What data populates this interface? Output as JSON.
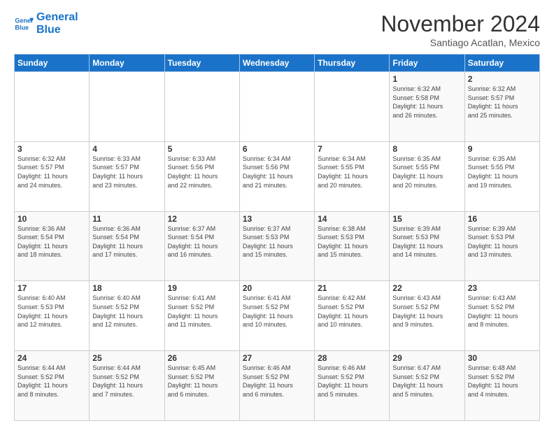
{
  "logo": {
    "line1": "General",
    "line2": "Blue"
  },
  "header": {
    "month": "November 2024",
    "location": "Santiago Acatlan, Mexico"
  },
  "weekdays": [
    "Sunday",
    "Monday",
    "Tuesday",
    "Wednesday",
    "Thursday",
    "Friday",
    "Saturday"
  ],
  "weeks": [
    [
      {
        "day": "",
        "info": ""
      },
      {
        "day": "",
        "info": ""
      },
      {
        "day": "",
        "info": ""
      },
      {
        "day": "",
        "info": ""
      },
      {
        "day": "",
        "info": ""
      },
      {
        "day": "1",
        "info": "Sunrise: 6:32 AM\nSunset: 5:58 PM\nDaylight: 11 hours\nand 26 minutes."
      },
      {
        "day": "2",
        "info": "Sunrise: 6:32 AM\nSunset: 5:57 PM\nDaylight: 11 hours\nand 25 minutes."
      }
    ],
    [
      {
        "day": "3",
        "info": "Sunrise: 6:32 AM\nSunset: 5:57 PM\nDaylight: 11 hours\nand 24 minutes."
      },
      {
        "day": "4",
        "info": "Sunrise: 6:33 AM\nSunset: 5:57 PM\nDaylight: 11 hours\nand 23 minutes."
      },
      {
        "day": "5",
        "info": "Sunrise: 6:33 AM\nSunset: 5:56 PM\nDaylight: 11 hours\nand 22 minutes."
      },
      {
        "day": "6",
        "info": "Sunrise: 6:34 AM\nSunset: 5:56 PM\nDaylight: 11 hours\nand 21 minutes."
      },
      {
        "day": "7",
        "info": "Sunrise: 6:34 AM\nSunset: 5:55 PM\nDaylight: 11 hours\nand 20 minutes."
      },
      {
        "day": "8",
        "info": "Sunrise: 6:35 AM\nSunset: 5:55 PM\nDaylight: 11 hours\nand 20 minutes."
      },
      {
        "day": "9",
        "info": "Sunrise: 6:35 AM\nSunset: 5:55 PM\nDaylight: 11 hours\nand 19 minutes."
      }
    ],
    [
      {
        "day": "10",
        "info": "Sunrise: 6:36 AM\nSunset: 5:54 PM\nDaylight: 11 hours\nand 18 minutes."
      },
      {
        "day": "11",
        "info": "Sunrise: 6:36 AM\nSunset: 5:54 PM\nDaylight: 11 hours\nand 17 minutes."
      },
      {
        "day": "12",
        "info": "Sunrise: 6:37 AM\nSunset: 5:54 PM\nDaylight: 11 hours\nand 16 minutes."
      },
      {
        "day": "13",
        "info": "Sunrise: 6:37 AM\nSunset: 5:53 PM\nDaylight: 11 hours\nand 15 minutes."
      },
      {
        "day": "14",
        "info": "Sunrise: 6:38 AM\nSunset: 5:53 PM\nDaylight: 11 hours\nand 15 minutes."
      },
      {
        "day": "15",
        "info": "Sunrise: 6:39 AM\nSunset: 5:53 PM\nDaylight: 11 hours\nand 14 minutes."
      },
      {
        "day": "16",
        "info": "Sunrise: 6:39 AM\nSunset: 5:53 PM\nDaylight: 11 hours\nand 13 minutes."
      }
    ],
    [
      {
        "day": "17",
        "info": "Sunrise: 6:40 AM\nSunset: 5:53 PM\nDaylight: 11 hours\nand 12 minutes."
      },
      {
        "day": "18",
        "info": "Sunrise: 6:40 AM\nSunset: 5:52 PM\nDaylight: 11 hours\nand 12 minutes."
      },
      {
        "day": "19",
        "info": "Sunrise: 6:41 AM\nSunset: 5:52 PM\nDaylight: 11 hours\nand 11 minutes."
      },
      {
        "day": "20",
        "info": "Sunrise: 6:41 AM\nSunset: 5:52 PM\nDaylight: 11 hours\nand 10 minutes."
      },
      {
        "day": "21",
        "info": "Sunrise: 6:42 AM\nSunset: 5:52 PM\nDaylight: 11 hours\nand 10 minutes."
      },
      {
        "day": "22",
        "info": "Sunrise: 6:43 AM\nSunset: 5:52 PM\nDaylight: 11 hours\nand 9 minutes."
      },
      {
        "day": "23",
        "info": "Sunrise: 6:43 AM\nSunset: 5:52 PM\nDaylight: 11 hours\nand 8 minutes."
      }
    ],
    [
      {
        "day": "24",
        "info": "Sunrise: 6:44 AM\nSunset: 5:52 PM\nDaylight: 11 hours\nand 8 minutes."
      },
      {
        "day": "25",
        "info": "Sunrise: 6:44 AM\nSunset: 5:52 PM\nDaylight: 11 hours\nand 7 minutes."
      },
      {
        "day": "26",
        "info": "Sunrise: 6:45 AM\nSunset: 5:52 PM\nDaylight: 11 hours\nand 6 minutes."
      },
      {
        "day": "27",
        "info": "Sunrise: 6:46 AM\nSunset: 5:52 PM\nDaylight: 11 hours\nand 6 minutes."
      },
      {
        "day": "28",
        "info": "Sunrise: 6:46 AM\nSunset: 5:52 PM\nDaylight: 11 hours\nand 5 minutes."
      },
      {
        "day": "29",
        "info": "Sunrise: 6:47 AM\nSunset: 5:52 PM\nDaylight: 11 hours\nand 5 minutes."
      },
      {
        "day": "30",
        "info": "Sunrise: 6:48 AM\nSunset: 5:52 PM\nDaylight: 11 hours\nand 4 minutes."
      }
    ]
  ]
}
